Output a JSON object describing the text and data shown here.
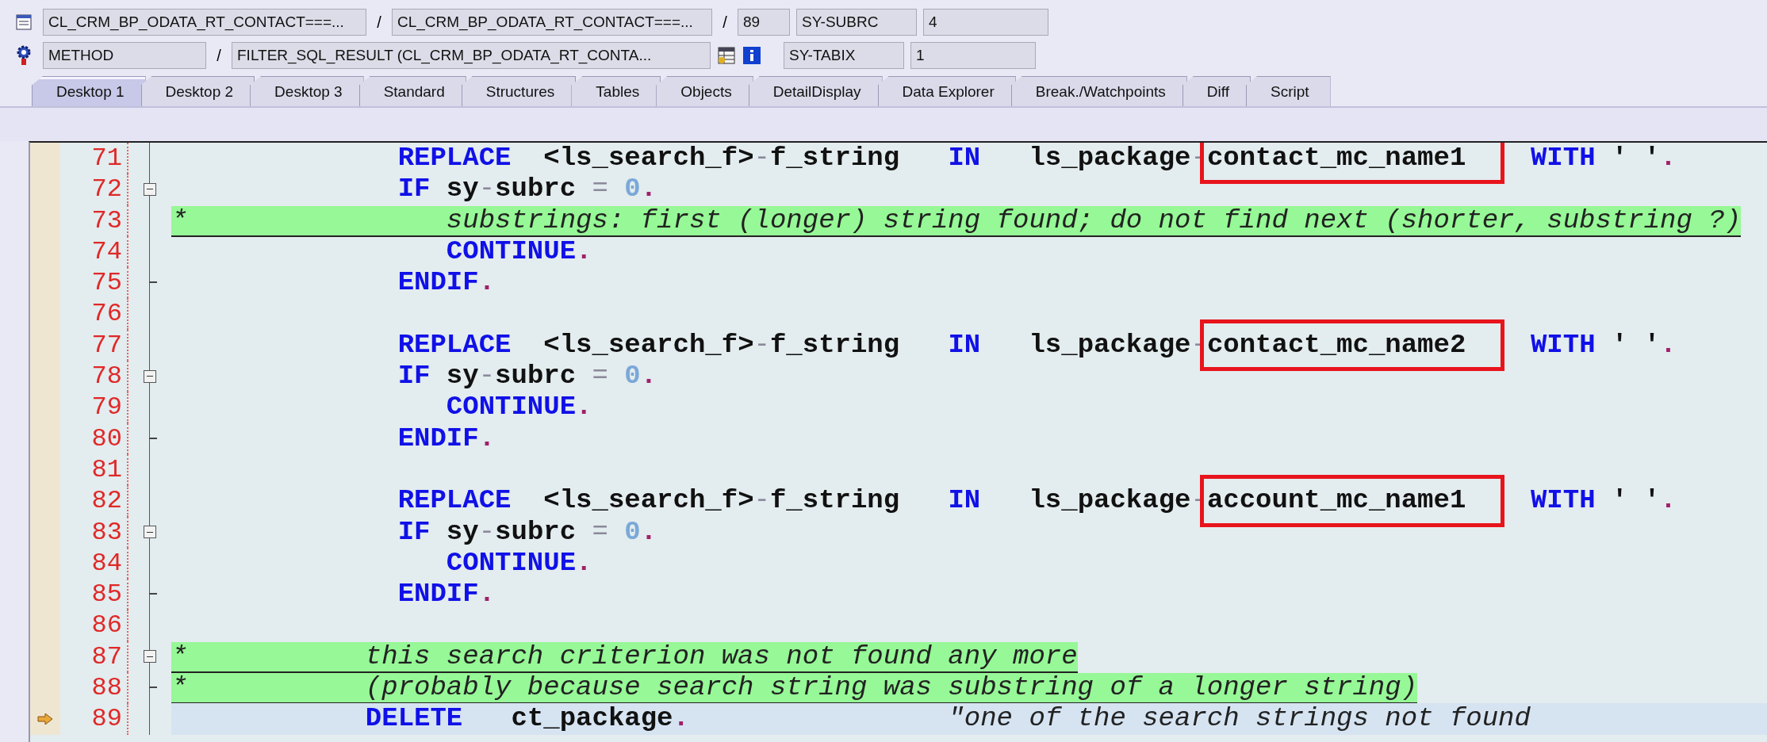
{
  "header": {
    "row1": {
      "program": "CL_CRM_BP_ODATA_RT_CONTACT===...",
      "include": "CL_CRM_BP_ODATA_RT_CONTACT===...",
      "line": "89",
      "var_name": "SY-SUBRC",
      "var_value": "4"
    },
    "row2": {
      "type": "METHOD",
      "name": "FILTER_SQL_RESULT (CL_CRM_BP_ODATA_RT_CONTA...",
      "var_name": "SY-TABIX",
      "var_value": "1"
    },
    "separators": [
      "/",
      "/",
      "/"
    ]
  },
  "tabs": [
    {
      "label": "Desktop 1",
      "selected": true
    },
    {
      "label": "Desktop 2",
      "selected": false
    },
    {
      "label": "Desktop 3",
      "selected": false
    },
    {
      "label": "Standard",
      "selected": false
    },
    {
      "label": "Structures",
      "selected": false
    },
    {
      "label": "Tables",
      "selected": false
    },
    {
      "label": "Objects",
      "selected": false
    },
    {
      "label": "DetailDisplay",
      "selected": false
    },
    {
      "label": "Data Explorer",
      "selected": false
    },
    {
      "label": "Break./Watchpoints",
      "selected": false
    },
    {
      "label": "Diff",
      "selected": false
    },
    {
      "label": "Script",
      "selected": false
    }
  ],
  "lines": [
    {
      "number": "71",
      "fold_open": false,
      "fold_end": false,
      "kind": "code",
      "current": false,
      "segments": [
        {
          "kind": "kw",
          "t": "              REPLACE"
        },
        {
          "kind": "id",
          "t": "  <ls_search_f>"
        },
        {
          "kind": "op",
          "t": "-"
        },
        {
          "kind": "id",
          "t": "f_string"
        },
        {
          "kind": "kw",
          "t": "   IN"
        },
        {
          "kind": "id",
          "t": "   ls_package"
        },
        {
          "kind": "op",
          "t": "-"
        },
        {
          "kind": "id",
          "t": "contact_mc_name1",
          "boxed": true
        },
        {
          "kind": "kw",
          "t": "    WITH"
        },
        {
          "kind": "id",
          "t": " ' '"
        },
        {
          "kind": "dot",
          "t": "."
        }
      ]
    },
    {
      "number": "72",
      "fold_open": true,
      "fold_end": false,
      "kind": "code",
      "current": false,
      "segments": [
        {
          "kind": "kw",
          "t": "              IF"
        },
        {
          "kind": "id",
          "t": " sy"
        },
        {
          "kind": "op",
          "t": "-"
        },
        {
          "kind": "id",
          "t": "subrc"
        },
        {
          "kind": "op",
          "t": " ="
        },
        {
          "kind": "num",
          "t": " 0"
        },
        {
          "kind": "dot",
          "t": "."
        }
      ]
    },
    {
      "number": "73",
      "fold_open": false,
      "fold_end": false,
      "kind": "comment",
      "current": false,
      "segments": [
        {
          "kind": "cmt",
          "t": "*                substrings: first (longer) string found; do not find next (shorter, substring ?)"
        }
      ]
    },
    {
      "number": "74",
      "fold_open": false,
      "fold_end": false,
      "kind": "code",
      "current": false,
      "segments": [
        {
          "kind": "kw",
          "t": "                 CONTINUE"
        },
        {
          "kind": "dot",
          "t": "."
        }
      ]
    },
    {
      "number": "75",
      "fold_open": false,
      "fold_end": true,
      "kind": "code",
      "current": false,
      "segments": [
        {
          "kind": "kw",
          "t": "              ENDIF"
        },
        {
          "kind": "dot",
          "t": "."
        }
      ]
    },
    {
      "number": "76",
      "fold_open": false,
      "fold_end": false,
      "kind": "code",
      "current": false
    },
    {
      "number": "77",
      "fold_open": false,
      "fold_end": false,
      "kind": "code",
      "current": false,
      "segments": [
        {
          "kind": "kw",
          "t": "              REPLACE"
        },
        {
          "kind": "id",
          "t": "  <ls_search_f>"
        },
        {
          "kind": "op",
          "t": "-"
        },
        {
          "kind": "id",
          "t": "f_string"
        },
        {
          "kind": "kw",
          "t": "   IN"
        },
        {
          "kind": "id",
          "t": "   ls_package"
        },
        {
          "kind": "op",
          "t": "-"
        },
        {
          "kind": "id",
          "t": "contact_mc_name2",
          "boxed": true
        },
        {
          "kind": "kw",
          "t": "    WITH"
        },
        {
          "kind": "id",
          "t": " ' '"
        },
        {
          "kind": "dot",
          "t": "."
        }
      ]
    },
    {
      "number": "78",
      "fold_open": true,
      "fold_end": false,
      "kind": "code",
      "current": false,
      "segments": [
        {
          "kind": "kw",
          "t": "              IF"
        },
        {
          "kind": "id",
          "t": " sy"
        },
        {
          "kind": "op",
          "t": "-"
        },
        {
          "kind": "id",
          "t": "subrc"
        },
        {
          "kind": "op",
          "t": " ="
        },
        {
          "kind": "num",
          "t": " 0"
        },
        {
          "kind": "dot",
          "t": "."
        }
      ]
    },
    {
      "number": "79",
      "fold_open": false,
      "fold_end": false,
      "kind": "code",
      "current": false,
      "segments": [
        {
          "kind": "kw",
          "t": "                 CONTINUE"
        },
        {
          "kind": "dot",
          "t": "."
        }
      ]
    },
    {
      "number": "80",
      "fold_open": false,
      "fold_end": true,
      "kind": "code",
      "current": false,
      "segments": [
        {
          "kind": "kw",
          "t": "              ENDIF"
        },
        {
          "kind": "dot",
          "t": "."
        }
      ]
    },
    {
      "number": "81",
      "fold_open": false,
      "fold_end": false,
      "kind": "code",
      "current": false
    },
    {
      "number": "82",
      "fold_open": false,
      "fold_end": false,
      "kind": "code",
      "current": false,
      "segments": [
        {
          "kind": "kw",
          "t": "              REPLACE"
        },
        {
          "kind": "id",
          "t": "  <ls_search_f>"
        },
        {
          "kind": "op",
          "t": "-"
        },
        {
          "kind": "id",
          "t": "f_string"
        },
        {
          "kind": "kw",
          "t": "   IN"
        },
        {
          "kind": "id",
          "t": "   ls_package"
        },
        {
          "kind": "op",
          "t": "-"
        },
        {
          "kind": "id",
          "t": "account_mc_name1",
          "boxed": true
        },
        {
          "kind": "kw",
          "t": "    WITH"
        },
        {
          "kind": "id",
          "t": " ' '"
        },
        {
          "kind": "dot",
          "t": "."
        }
      ]
    },
    {
      "number": "83",
      "fold_open": true,
      "fold_end": false,
      "kind": "code",
      "current": false,
      "segments": [
        {
          "kind": "kw",
          "t": "              IF"
        },
        {
          "kind": "id",
          "t": " sy"
        },
        {
          "kind": "op",
          "t": "-"
        },
        {
          "kind": "id",
          "t": "subrc"
        },
        {
          "kind": "op",
          "t": " ="
        },
        {
          "kind": "num",
          "t": " 0"
        },
        {
          "kind": "dot",
          "t": "."
        }
      ]
    },
    {
      "number": "84",
      "fold_open": false,
      "fold_end": false,
      "kind": "code",
      "current": false,
      "segments": [
        {
          "kind": "kw",
          "t": "                 CONTINUE"
        },
        {
          "kind": "dot",
          "t": "."
        }
      ]
    },
    {
      "number": "85",
      "fold_open": false,
      "fold_end": true,
      "kind": "code",
      "current": false,
      "segments": [
        {
          "kind": "kw",
          "t": "              ENDIF"
        },
        {
          "kind": "dot",
          "t": "."
        }
      ]
    },
    {
      "number": "86",
      "fold_open": false,
      "fold_end": false,
      "kind": "code",
      "current": false
    },
    {
      "number": "87",
      "fold_open": true,
      "fold_end": false,
      "kind": "comment",
      "current": false,
      "segments": [
        {
          "kind": "cmt",
          "t": "*           this search criterion was not found any more"
        }
      ]
    },
    {
      "number": "88",
      "fold_open": false,
      "fold_end": true,
      "kind": "comment",
      "current": false,
      "segments": [
        {
          "kind": "cmt",
          "t": "*           (probably because search string was substring of a longer string)"
        }
      ]
    },
    {
      "number": "89",
      "fold_open": false,
      "fold_end": false,
      "kind": "code",
      "current": true,
      "segments": [
        {
          "kind": "kw",
          "t": "            DELETE"
        },
        {
          "kind": "id",
          "t": "   ct_package"
        },
        {
          "kind": "dot",
          "t": "."
        },
        {
          "kind": "cmt",
          "t": "                \"one of the search strings not found"
        }
      ]
    }
  ]
}
